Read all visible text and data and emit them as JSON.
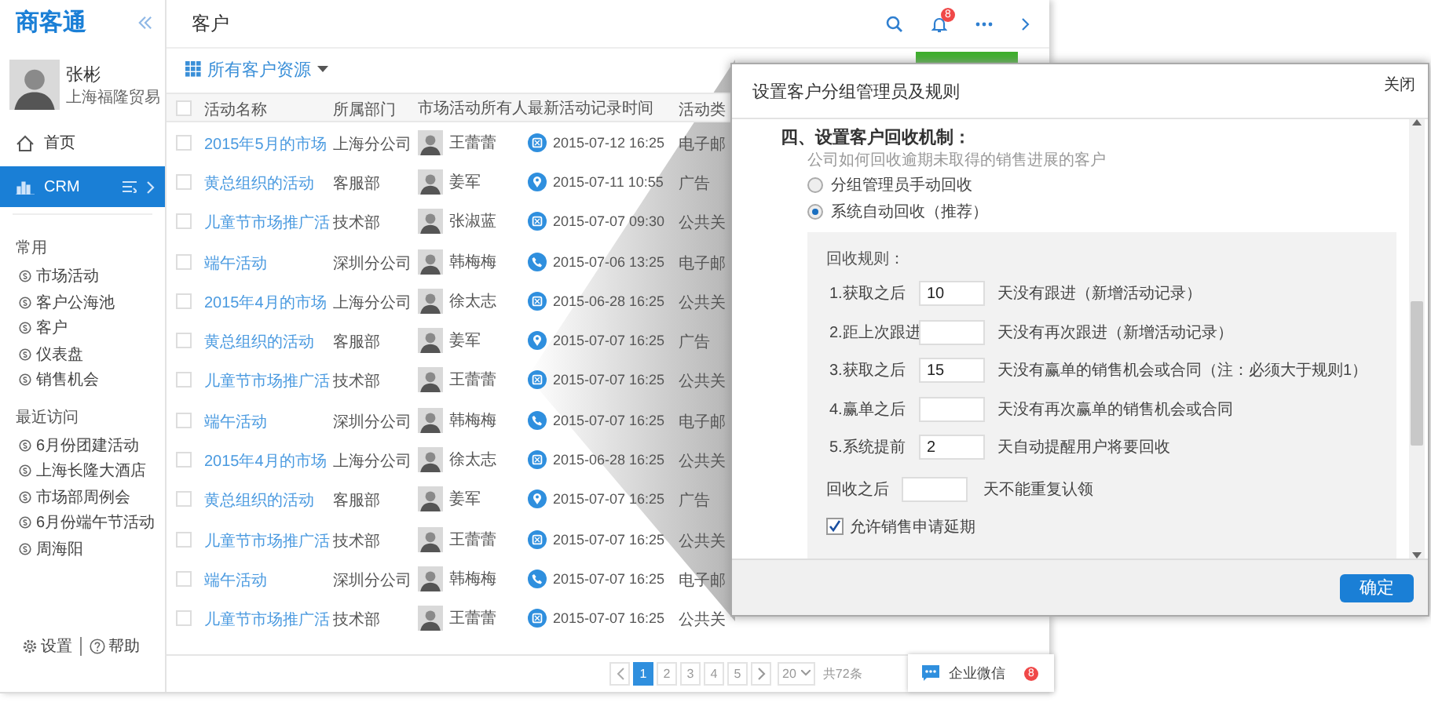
{
  "app": {
    "logo": "商客通",
    "user": {
      "name": "张彬",
      "company": "上海福隆贸易"
    },
    "nav": [
      {
        "label": "首页",
        "kind": "home",
        "selected": false
      },
      {
        "label": "CRM",
        "kind": "crm",
        "selected": true
      }
    ],
    "sections": [
      {
        "title": "常用",
        "items": [
          "市场活动",
          "客户公海池",
          "客户",
          "仪表盘",
          "销售机会"
        ]
      },
      {
        "title": "最近访问",
        "items": [
          "6月份团建活动",
          "上海长隆大酒店",
          "市场部周例会",
          "6月份端午节活动",
          "周海阳"
        ]
      }
    ],
    "footer_links": [
      {
        "label": "设置",
        "kind": "settings"
      },
      {
        "label": "帮助",
        "kind": "help"
      }
    ]
  },
  "header": {
    "title": "客户",
    "notification_count": "8"
  },
  "filter": {
    "label": "所有客户资源"
  },
  "table": {
    "all_checked": false,
    "columns": [
      "活动名称",
      "所属部门",
      "市场活动所有人",
      "最新活动记录时间",
      "活动类"
    ],
    "rows": [
      {
        "checked": false,
        "name": "2015年5月的市场",
        "department": "上海分公司",
        "owner": "王蕾蕾",
        "record": {
          "kind": "mail",
          "time": "2015-07-12 16:25"
        },
        "type": "电子邮"
      },
      {
        "checked": false,
        "name": "黄总组织的活动",
        "department": "客服部",
        "owner": "姜军",
        "record": {
          "kind": "pin",
          "time": "2015-07-11 10:55"
        },
        "type": "广告"
      },
      {
        "checked": false,
        "name": "儿童节市场推广活",
        "department": "技术部",
        "owner": "张淑蓝",
        "record": {
          "kind": "mail",
          "time": "2015-07-07 09:30"
        },
        "type": "公共关"
      },
      {
        "checked": false,
        "name": "端午活动",
        "department": "深圳分公司",
        "owner": "韩梅梅",
        "record": {
          "kind": "phone",
          "time": "2015-07-06 13:25"
        },
        "type": "电子邮"
      },
      {
        "checked": false,
        "name": "2015年4月的市场",
        "department": "上海分公司",
        "owner": "徐太志",
        "record": {
          "kind": "mail",
          "time": "2015-06-28 16:25"
        },
        "type": "公共关"
      },
      {
        "checked": false,
        "name": "黄总组织的活动",
        "department": "客服部",
        "owner": "姜军",
        "record": {
          "kind": "pin",
          "time": "2015-07-07 16:25"
        },
        "type": "广告"
      },
      {
        "checked": false,
        "name": "儿童节市场推广活",
        "department": "技术部",
        "owner": "王蕾蕾",
        "record": {
          "kind": "mail",
          "time": "2015-07-07 16:25"
        },
        "type": "公共关"
      },
      {
        "checked": false,
        "name": "端午活动",
        "department": "深圳分公司",
        "owner": "韩梅梅",
        "record": {
          "kind": "phone",
          "time": "2015-07-07 16:25"
        },
        "type": "电子邮"
      },
      {
        "checked": false,
        "name": "2015年4月的市场",
        "department": "上海分公司",
        "owner": "徐太志",
        "record": {
          "kind": "mail",
          "time": "2015-06-28 16:25"
        },
        "type": "公共关"
      },
      {
        "checked": false,
        "name": "黄总组织的活动",
        "department": "客服部",
        "owner": "姜军",
        "record": {
          "kind": "pin",
          "time": "2015-07-07 16:25"
        },
        "type": "广告"
      },
      {
        "checked": false,
        "name": "儿童节市场推广活",
        "department": "技术部",
        "owner": "王蕾蕾",
        "record": {
          "kind": "mail",
          "time": "2015-07-07 16:25"
        },
        "type": "公共关"
      },
      {
        "checked": false,
        "name": "端午活动",
        "department": "深圳分公司",
        "owner": "韩梅梅",
        "record": {
          "kind": "phone",
          "time": "2015-07-07 16:25"
        },
        "type": "电子邮"
      },
      {
        "checked": false,
        "name": "儿童节市场推广活",
        "department": "技术部",
        "owner": "王蕾蕾",
        "record": {
          "kind": "mail",
          "time": "2015-07-07 16:25"
        },
        "type": "公共关"
      }
    ]
  },
  "pagination": {
    "pages": [
      {
        "label": "1",
        "selected": true
      },
      {
        "label": "2",
        "selected": false
      },
      {
        "label": "3",
        "selected": false
      },
      {
        "label": "4",
        "selected": false
      },
      {
        "label": "5",
        "selected": false
      }
    ],
    "page_size": "20",
    "total": "共72条"
  },
  "chat": {
    "label": "企业微信",
    "badge": "8"
  },
  "dialog": {
    "title": "设置客户分组管理员及规则",
    "close": "关闭",
    "section": "四、设置客户回收机制：",
    "hint": "公司如何回收逾期未取得的销售进展的客户",
    "options": [
      {
        "label": "分组管理员手动回收",
        "selected": false
      },
      {
        "label": "系统自动回收（推荐）",
        "selected": true
      }
    ],
    "rules_title": "回收规则：",
    "rules": [
      {
        "label": "1.获取之后",
        "value": "10",
        "description": "天没有跟进（新增活动记录）"
      },
      {
        "label": "2.距上次跟进",
        "description": "天没有再次跟进（新增活动记录）"
      },
      {
        "label": "3.获取之后",
        "value": "15",
        "description": "天没有赢单的销售机会或合同（注：必须大于规则1）"
      },
      {
        "label": "4.赢单之后",
        "description": "天没有再次赢单的销售机会或合同"
      },
      {
        "label": "5.系统提前",
        "value": "2",
        "description": "天自动提醒用户将要回收"
      }
    ],
    "after": {
      "label": "回收之后",
      "description": "天不能重复认领"
    },
    "allow_extension": {
      "label": "允许销售申请延期",
      "checked": true
    },
    "confirm": "确定"
  }
}
